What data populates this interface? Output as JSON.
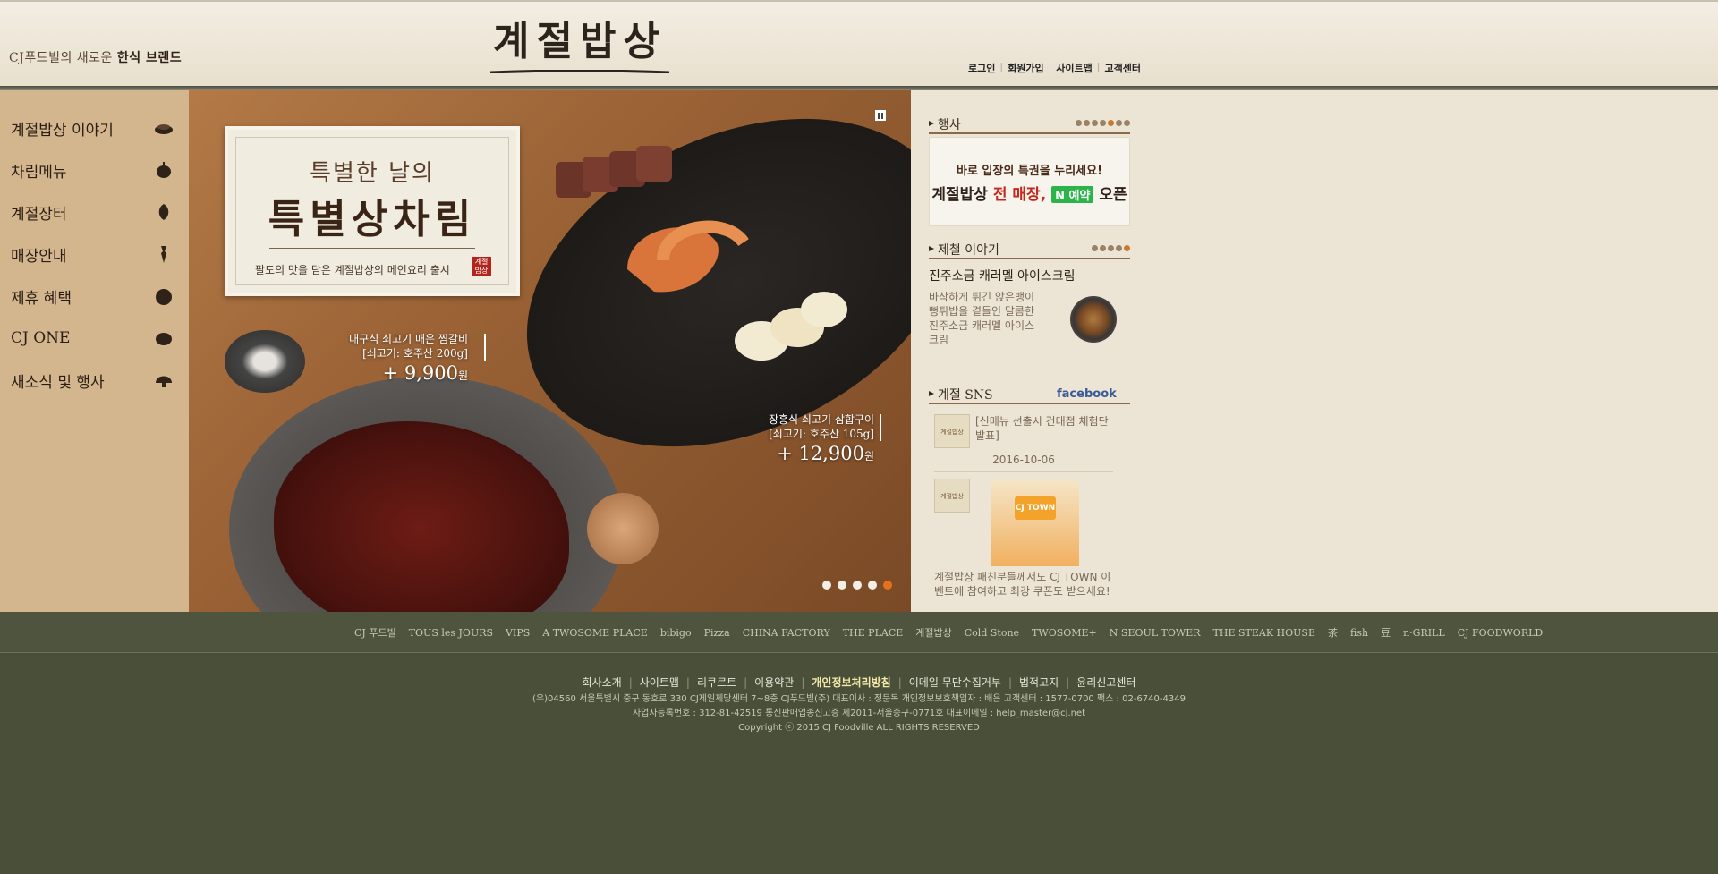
{
  "header": {
    "slogan_prefix": "CJ푸드빌의 새로운 ",
    "slogan_bold": "한식 브랜드",
    "logo_text": "계절밥상",
    "util_nav": [
      "로그인",
      "회원가입",
      "사이트맵",
      "고객센터"
    ]
  },
  "sidebar": {
    "items": [
      {
        "label": "계절밥상 이야기",
        "icon": "bowl-icon"
      },
      {
        "label": "차림메뉴",
        "icon": "pumpkin-icon"
      },
      {
        "label": "계절장터",
        "icon": "leaf-icon"
      },
      {
        "label": "매장안내",
        "icon": "radish-icon"
      },
      {
        "label": "제휴 혜택",
        "icon": "chestnut-icon"
      },
      {
        "label": "CJ ONE",
        "icon": "apple-icon"
      },
      {
        "label": "새소식 및 행사",
        "icon": "mushroom-icon"
      }
    ]
  },
  "hero": {
    "subtitle": "특별한 날의",
    "title": "특별상차림",
    "desc": "팔도의 맛을 담은 계절밥상의 메인요리 출시",
    "seal": "계절밥상",
    "price1": {
      "name1": "대구식 쇠고기 매운 찜갈비",
      "name2": "[쇠고기: 호주산 200g]",
      "value": "+ 9,900",
      "unit": "원"
    },
    "price2": {
      "name1": "장흥식 쇠고기 삼합구이",
      "name2": "[쇠고기: 호주산 105g]",
      "value": "+ 12,900",
      "unit": "원"
    },
    "dots": 5,
    "active_dot": 4
  },
  "right": {
    "event": {
      "title": "행사",
      "line1": "바로 입장의 특권을 누리세요!",
      "line2_a": "계절밥상 ",
      "line2_red": "전 매장,",
      "line2_badge": "N 예약",
      "line2_b": "오픈"
    },
    "story": {
      "title": "제철 이야기",
      "item_title": "진주소금 캐러멜 아이스크림",
      "item_desc": "바삭하게 튀긴 앉은뱅이 뻥튀밥을 곁들인 달콤한 진주소금 캐러멜 아이스크림"
    },
    "sns": {
      "title": "계절 SNS",
      "facebook": "facebook",
      "thumb_label": "계절밥상",
      "post1_text": "[신메뉴 선출시 건대점 체험단 발표]",
      "post1_date": "2016-10-06",
      "poster_text": "CJ TOWN",
      "post2_text": "계절밥상 패친분들께서도 CJ TOWN 이벤트에 참여하고 최강 쿠폰도 받으세요!"
    }
  },
  "brands": [
    "CJ 푸드빌",
    "TOUS les JOURS",
    "VIPS",
    "A TWOSOME PLACE",
    "bibigo",
    "Pizza",
    "CHINA FACTORY",
    "THE PLACE",
    "계절밥상",
    "Cold Stone",
    "TWOSOME+",
    "N SEOUL TOWER",
    "THE STEAK HOUSE",
    "茶",
    "fish",
    "豆",
    "n·GRILL",
    "CJ FOODWORLD"
  ],
  "footer": {
    "links": [
      "회사소개",
      "사이트맵",
      "리쿠르트",
      "이용약관",
      "개인정보처리방침",
      "이메일 무단수집거부",
      "법적고지",
      "윤리신고센터"
    ],
    "highlight_index": 4,
    "line1": "(우)04560 서울특별시 중구 동호로 330 CJ제일제당센터 7~8층 CJ푸드빌(주)    대표이사 : 정문목    개인정보보호책임자 : 배은    고객센터 : 1577-0700    팩스 : 02-6740-4349",
    "line2": "사업자등록번호 : 312-81-42519    통신판매업종신고증 제2011-서울중구-0771호    대표이메일 : help_master@cj.net",
    "line3": "Copyright ⓒ 2015 CJ Foodville ALL RIGHTS RESERVED"
  },
  "colors": {
    "sidebar_bg": "#d4b68e",
    "footer_bg": "#4a4f3a",
    "accent_orange": "#e8701d",
    "naver_green": "#2bb44a"
  }
}
